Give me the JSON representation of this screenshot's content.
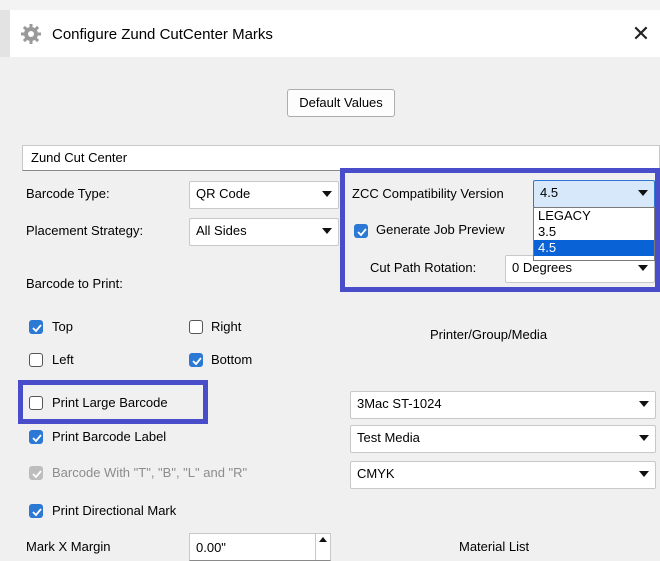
{
  "window": {
    "title": "Configure Zund CutCenter Marks",
    "close_glyph": "✕"
  },
  "header": {
    "default_values_label": "Default Values"
  },
  "name_field": {
    "value": "Zund Cut Center"
  },
  "barcode_type": {
    "label": "Barcode Type:",
    "value": "QR Code"
  },
  "placement_strategy": {
    "label": "Placement Strategy:",
    "value": "All Sides"
  },
  "zcc_version": {
    "label": "ZCC Compatibility Version",
    "value": "4.5",
    "options": [
      "LEGACY",
      "3.5",
      "4.5"
    ],
    "selected_index": 2
  },
  "generate_job_preview": {
    "label": "Generate Job Preview",
    "checked": true
  },
  "cut_path_rotation": {
    "label": "Cut Path Rotation:",
    "value": "0 Degrees"
  },
  "barcode_to_print": {
    "label": "Barcode to Print:",
    "top": {
      "label": "Top",
      "checked": true
    },
    "right": {
      "label": "Right",
      "checked": false
    },
    "left": {
      "label": "Left",
      "checked": false
    },
    "bottom": {
      "label": "Bottom",
      "checked": true
    }
  },
  "printer_group_media": {
    "label": "Printer/Group/Media",
    "printer": "3Mac ST-1024",
    "media": "Test Media",
    "color_mode": "CMYK"
  },
  "options": {
    "print_large_barcode": {
      "label": "Print Large Barcode",
      "checked": false
    },
    "print_barcode_label": {
      "label": "Print Barcode Label",
      "checked": true
    },
    "barcode_with_trbl": {
      "label": "Barcode With \"T\", \"B\", \"L\" and \"R\"",
      "checked": true,
      "disabled": true
    },
    "print_directional_mark": {
      "label": "Print Directional Mark",
      "checked": true
    }
  },
  "mark_x_margin": {
    "label": "Mark X Margin",
    "value": "0.00\""
  },
  "material_list": {
    "label": "Material List"
  },
  "colors": {
    "accent": "#2b78d5",
    "highlight": "#4a4dc9",
    "dropdown_selection": "#0a63d6"
  }
}
